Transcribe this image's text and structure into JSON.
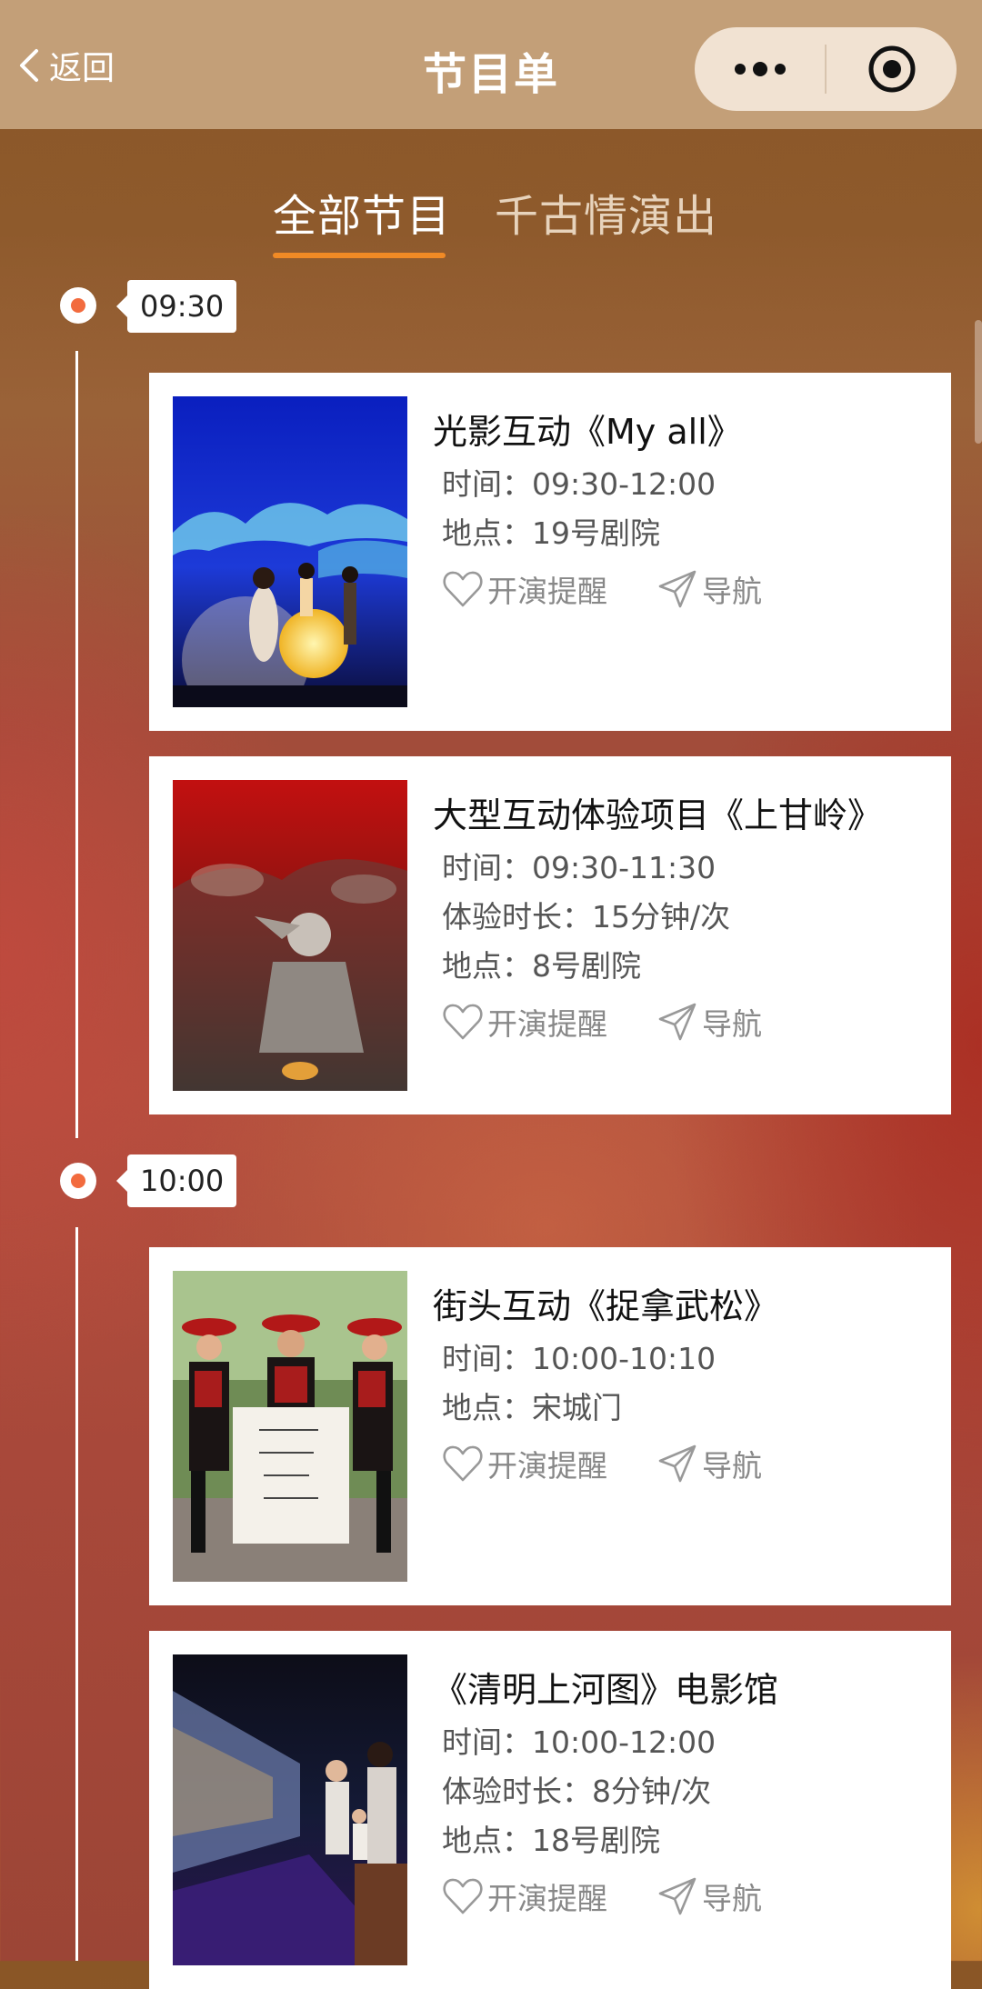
{
  "header": {
    "back_label": "返回",
    "title": "节目单"
  },
  "tabs": [
    {
      "label": "全部节目",
      "active": true
    },
    {
      "label": "千古情演出",
      "active": false
    }
  ],
  "colors": {
    "header_bg": "#c39f78",
    "tab_accent": "#f08a25",
    "timeline_dot": "#f26b3e"
  },
  "timeline": [
    {
      "time": "09:30"
    },
    {
      "time": "10:00"
    }
  ],
  "shows": [
    {
      "title": "光影互动《My all》",
      "lines": [
        "时间：09:30-12:00",
        "地点：19号剧院"
      ],
      "remind_label": "开演提醒",
      "nav_label": "导航"
    },
    {
      "title": "大型互动体验项目《上甘岭》",
      "lines": [
        "时间：09:30-11:30",
        "体验时长：15分钟/次",
        "地点：8号剧院"
      ],
      "remind_label": "开演提醒",
      "nav_label": "导航"
    },
    {
      "title": "街头互动《捉拿武松》",
      "lines": [
        "时间：10:00-10:10",
        "地点：宋城门"
      ],
      "remind_label": "开演提醒",
      "nav_label": "导航"
    },
    {
      "title": "《清明上河图》电影馆",
      "lines": [
        "时间：10:00-12:00",
        "体验时长：8分钟/次",
        "地点：18号剧院"
      ],
      "remind_label": "开演提醒",
      "nav_label": "导航"
    }
  ]
}
